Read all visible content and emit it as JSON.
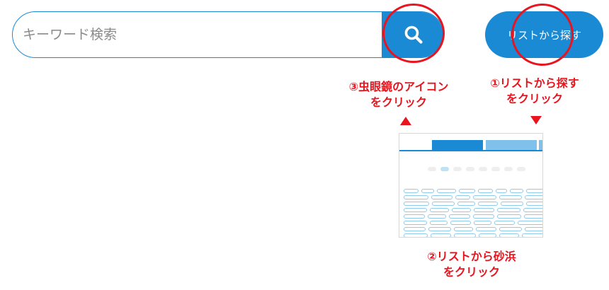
{
  "search": {
    "placeholder": "キーワード検索",
    "value": "",
    "button_icon": "search-icon"
  },
  "list_button": {
    "label": "リストから探す"
  },
  "annotations": {
    "step3": {
      "line1": "③虫眼鏡のアイコン",
      "line2": "をクリック"
    },
    "step1": {
      "line1": "①リストから探す",
      "line2": "をクリック"
    },
    "step2": {
      "line1": "②リストから砂浜",
      "line2": "をクリック"
    }
  },
  "colors": {
    "accent": "#1a8ad4",
    "annotation": "#e8141e",
    "tab_inactive": "#7fc1ea"
  },
  "thumbnail": {
    "tabs": [
      "",
      "",
      ""
    ],
    "heading": "",
    "section": ""
  }
}
